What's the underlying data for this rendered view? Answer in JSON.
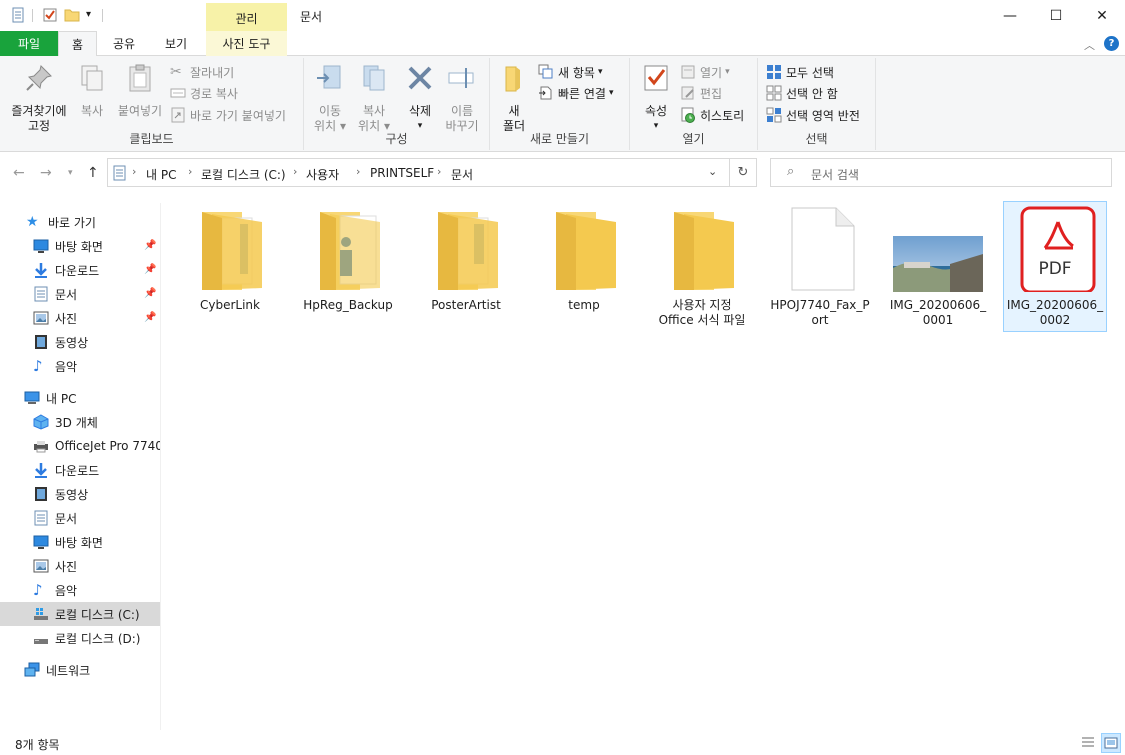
{
  "window": {
    "title": "문서",
    "context_tab_label": "관리",
    "minimize_glyph": "—",
    "maximize_glyph": "☐",
    "close_glyph": "✕"
  },
  "tabs": {
    "file": "파일",
    "home": "홈",
    "share": "공유",
    "view": "보기",
    "picture_tools": "사진 도구"
  },
  "ribbon": {
    "clipboard": {
      "label": "클립보드",
      "pin_line1": "즐겨찾기에",
      "pin_line2": "고정",
      "copy": "복사",
      "paste": "붙여넣기",
      "cut": "잘라내기",
      "copy_path": "경로 복사",
      "paste_shortcut": "바로 가기 붙여넣기"
    },
    "organize": {
      "label": "구성",
      "move_line1": "이동",
      "move_line2": "위치",
      "copyto_line1": "복사",
      "copyto_line2": "위치",
      "delete": "삭제",
      "rename_line1": "이름",
      "rename_line2": "바꾸기"
    },
    "new": {
      "label": "새로 만들기",
      "folder_line1": "새",
      "folder_line2": "폴더",
      "new_item": "새 항목",
      "easy_access": "빠른 연결"
    },
    "open": {
      "label": "열기",
      "properties": "속성",
      "open": "열기",
      "edit": "편집",
      "history": "히스토리"
    },
    "select": {
      "label": "선택",
      "select_all": "모두 선택",
      "select_none": "선택 안 함",
      "invert": "선택 영역 반전"
    }
  },
  "address": {
    "crumbs": [
      "내 PC",
      "로컬 디스크 (C:)",
      "사용자",
      "PRINTSELF",
      "문서"
    ],
    "search_placeholder": "문서 검색"
  },
  "nav": {
    "quick_access": "바로 가기",
    "quick_items": [
      "바탕 화면",
      "다운로드",
      "문서",
      "사진",
      "동영상",
      "음악"
    ],
    "this_pc": "내 PC",
    "pc_items": [
      "3D 개체",
      "OfficeJet Pro 7740 ",
      "다운로드",
      "동영상",
      "문서",
      "바탕 화면",
      "사진",
      "음악",
      "로컬 디스크 (C:)",
      "로컬 디스크 (D:)"
    ],
    "network": "네트워크"
  },
  "files": [
    {
      "line1": "CyberLink",
      "line2": "",
      "icon": "folder-icon"
    },
    {
      "line1": "HpReg_Backup",
      "line2": "",
      "icon": "folder-icon"
    },
    {
      "line1": "PosterArtist",
      "line2": "",
      "icon": "folder-icon"
    },
    {
      "line1": "temp",
      "line2": "",
      "icon": "folder-icon"
    },
    {
      "line1": "사용자 지정",
      "line2": "Office 서식 파일",
      "icon": "folder-icon"
    },
    {
      "line1": "HPOJ7740_Fax_P",
      "line2": "ort",
      "icon": "blank-file-icon"
    },
    {
      "line1": "IMG_20200606_",
      "line2": "0001",
      "icon": "image-thumbnail"
    },
    {
      "line1": "IMG_20200606_",
      "line2": "0002",
      "icon": "pdf-icon",
      "pdf_label": "PDF"
    }
  ],
  "status": {
    "count": "8개 항목"
  },
  "colors": {
    "file_tab": "#19a33c",
    "context_tab": "#f7f2a8",
    "selection": "#e5f3ff",
    "folder": "#f8d775",
    "pdf_red": "#e02020"
  }
}
